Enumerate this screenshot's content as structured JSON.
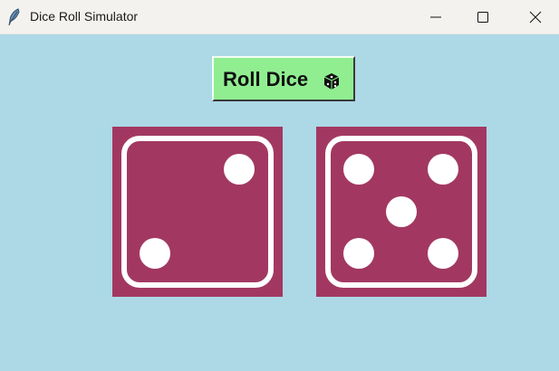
{
  "window": {
    "title": "Dice Roll Simulator",
    "icon": "feather-icon",
    "controls": [
      "minimize-icon",
      "maximize-icon",
      "close-icon"
    ]
  },
  "roll_button": {
    "label": "Roll Dice",
    "icon": "dice-icon",
    "color": "#90ee90"
  },
  "dice": [
    {
      "value": 2
    },
    {
      "value": 5
    }
  ],
  "colors": {
    "background": "#add8e6",
    "die_face": "#a23861",
    "pip": "#ffffff"
  }
}
